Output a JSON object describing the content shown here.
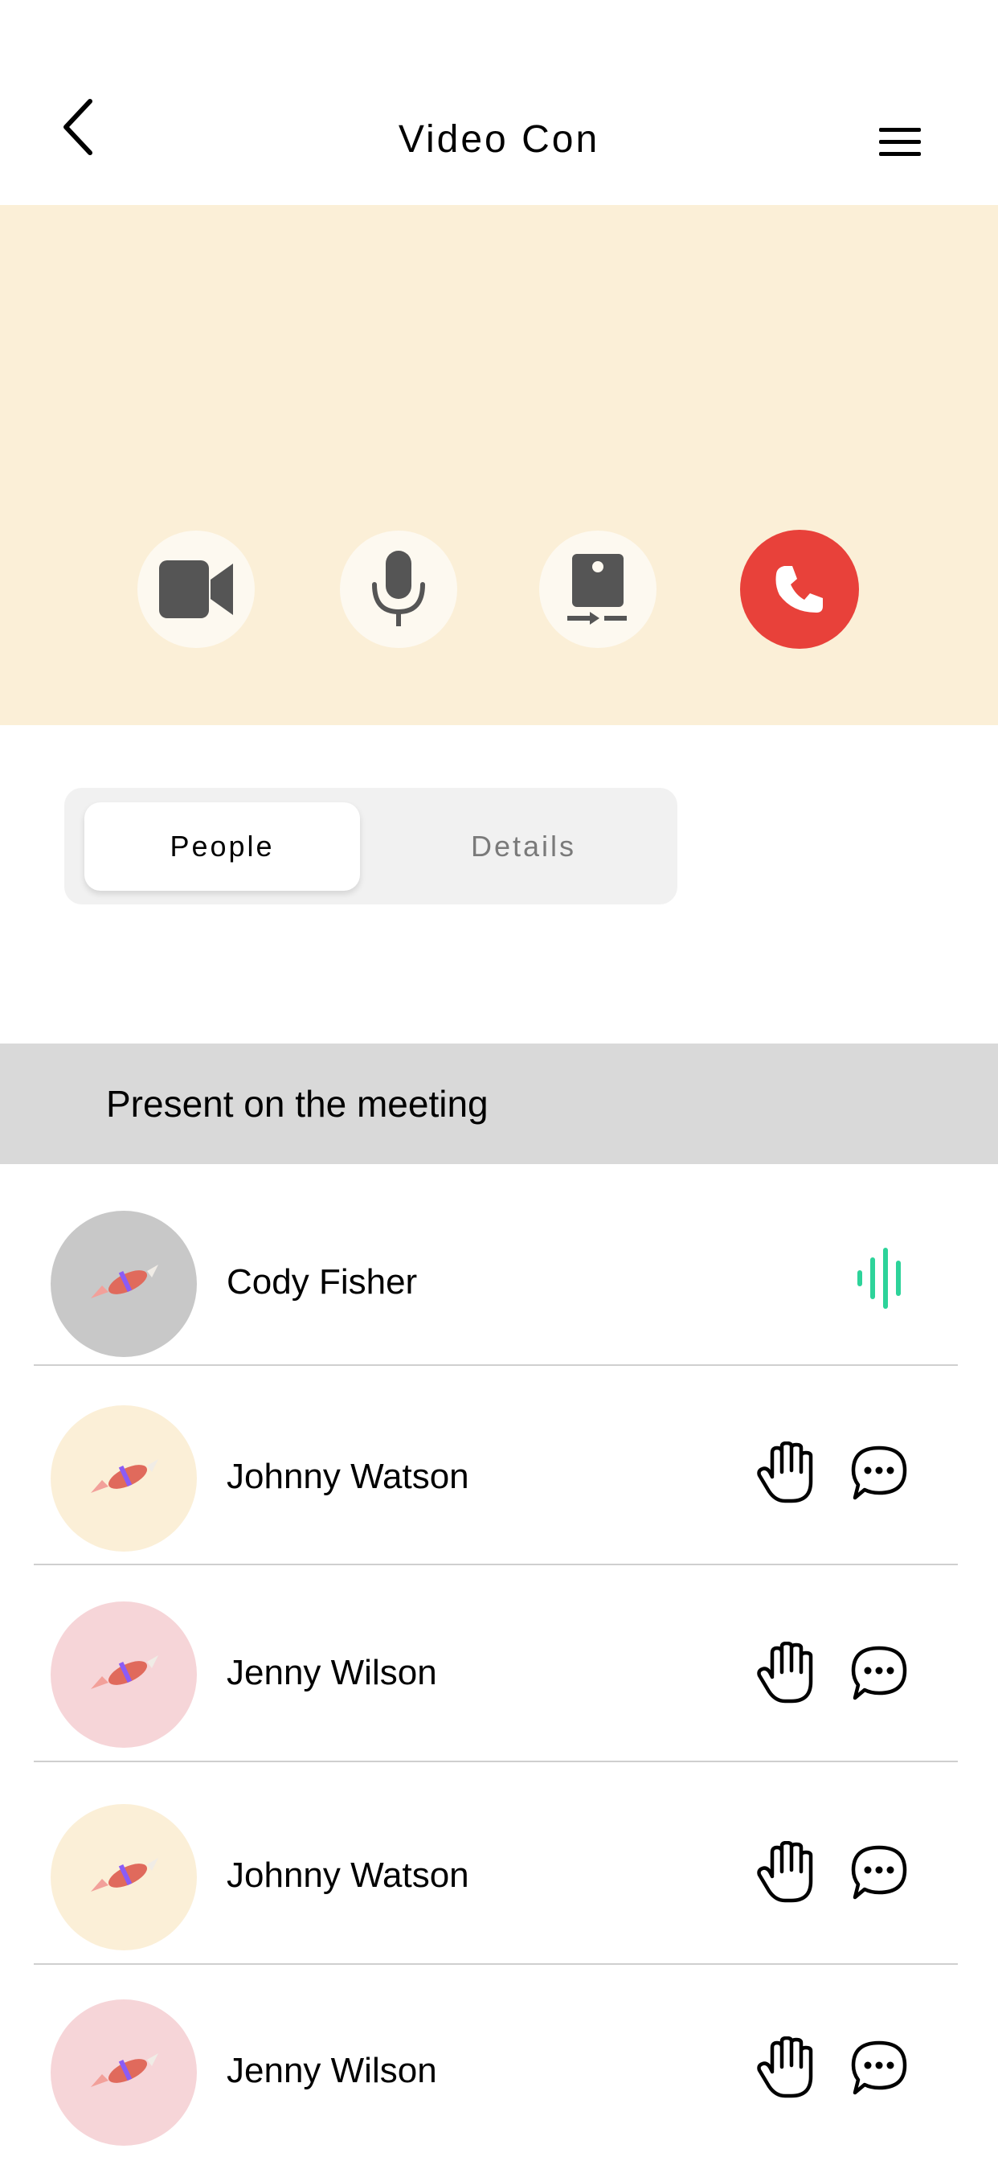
{
  "header": {
    "title": "Video Con",
    "back_icon": "chevron-left-icon",
    "menu_icon": "hamburger-menu-icon"
  },
  "controls": {
    "camera_icon": "video-camera-icon",
    "mic_icon": "microphone-icon",
    "share_icon": "screen-share-icon",
    "end_call_icon": "phone-end-icon",
    "end_call_color": "#e8413a"
  },
  "tabs": [
    {
      "label": "People",
      "active": true
    },
    {
      "label": "Details",
      "active": false
    }
  ],
  "section": {
    "title": "Present on the meeting"
  },
  "participants": [
    {
      "name": "Cody Fisher",
      "avatar_bg": "#c8c8c8",
      "status": "speaking"
    },
    {
      "name": "Johnny Watson",
      "avatar_bg": "#fbefd7",
      "status": "idle"
    },
    {
      "name": "Jenny Wilson",
      "avatar_bg": "#f6d5d8",
      "status": "idle"
    },
    {
      "name": "Johnny Watson",
      "avatar_bg": "#fbefd7",
      "status": "idle"
    },
    {
      "name": "Jenny Wilson",
      "avatar_bg": "#f6d5d8",
      "status": "idle"
    }
  ],
  "colors": {
    "video_bg": "#fbefd7",
    "speaking_indicator": "#2dd39a"
  }
}
